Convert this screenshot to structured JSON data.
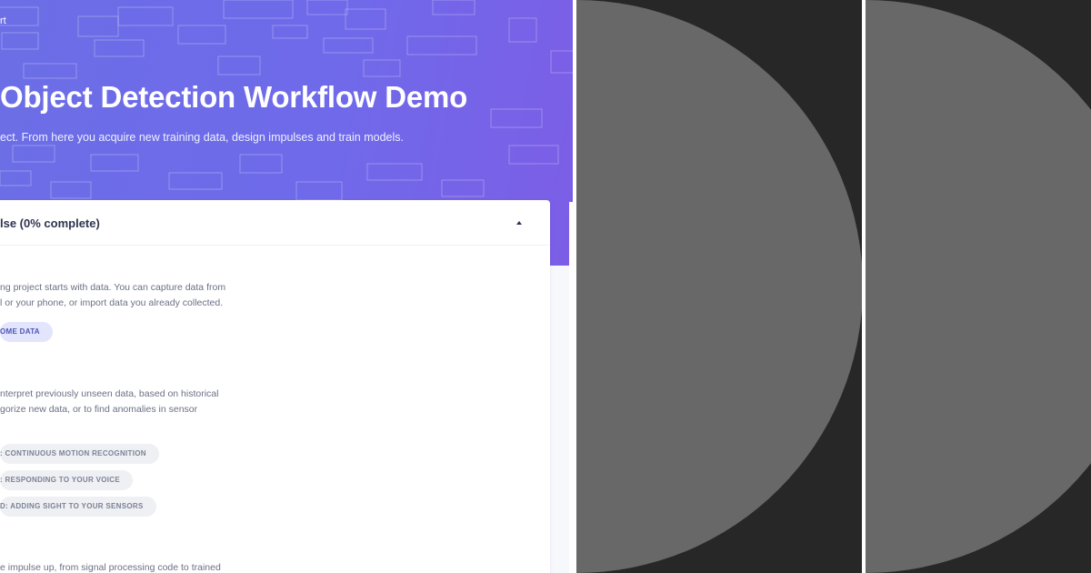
{
  "hero": {
    "crumb": "rt",
    "title": "Object Detection Workflow Demo",
    "subtitle": "ect. From here you acquire new training data, design impulses and train models."
  },
  "card": {
    "title": "lse (0% complete)",
    "sections": [
      {
        "lines": [
          "ng project starts with data. You can capture data from",
          "l or your phone, or import data you already collected."
        ],
        "buttons": [
          "OME DATA"
        ]
      },
      {
        "lines": [
          "nterpret previously unseen data, based on historical",
          "gorize new data, or to find anomalies in sensor"
        ],
        "buttons": [
          ": CONTINUOUS MOTION RECOGNITION",
          ": RESPONDING TO YOUR VOICE",
          "D: ADDING SIGHT TO YOUR SENSORS"
        ]
      },
      {
        "lines": [
          "e impulse up, from signal processing code to trained"
        ]
      }
    ]
  },
  "colors": {
    "hero_gradient_start": "#6c6ee6",
    "hero_gradient_end": "#7c5ee6",
    "panel_bg": "#272727",
    "circle_fill": "#686868"
  },
  "icons": {
    "collapse": "caret-up-icon"
  }
}
